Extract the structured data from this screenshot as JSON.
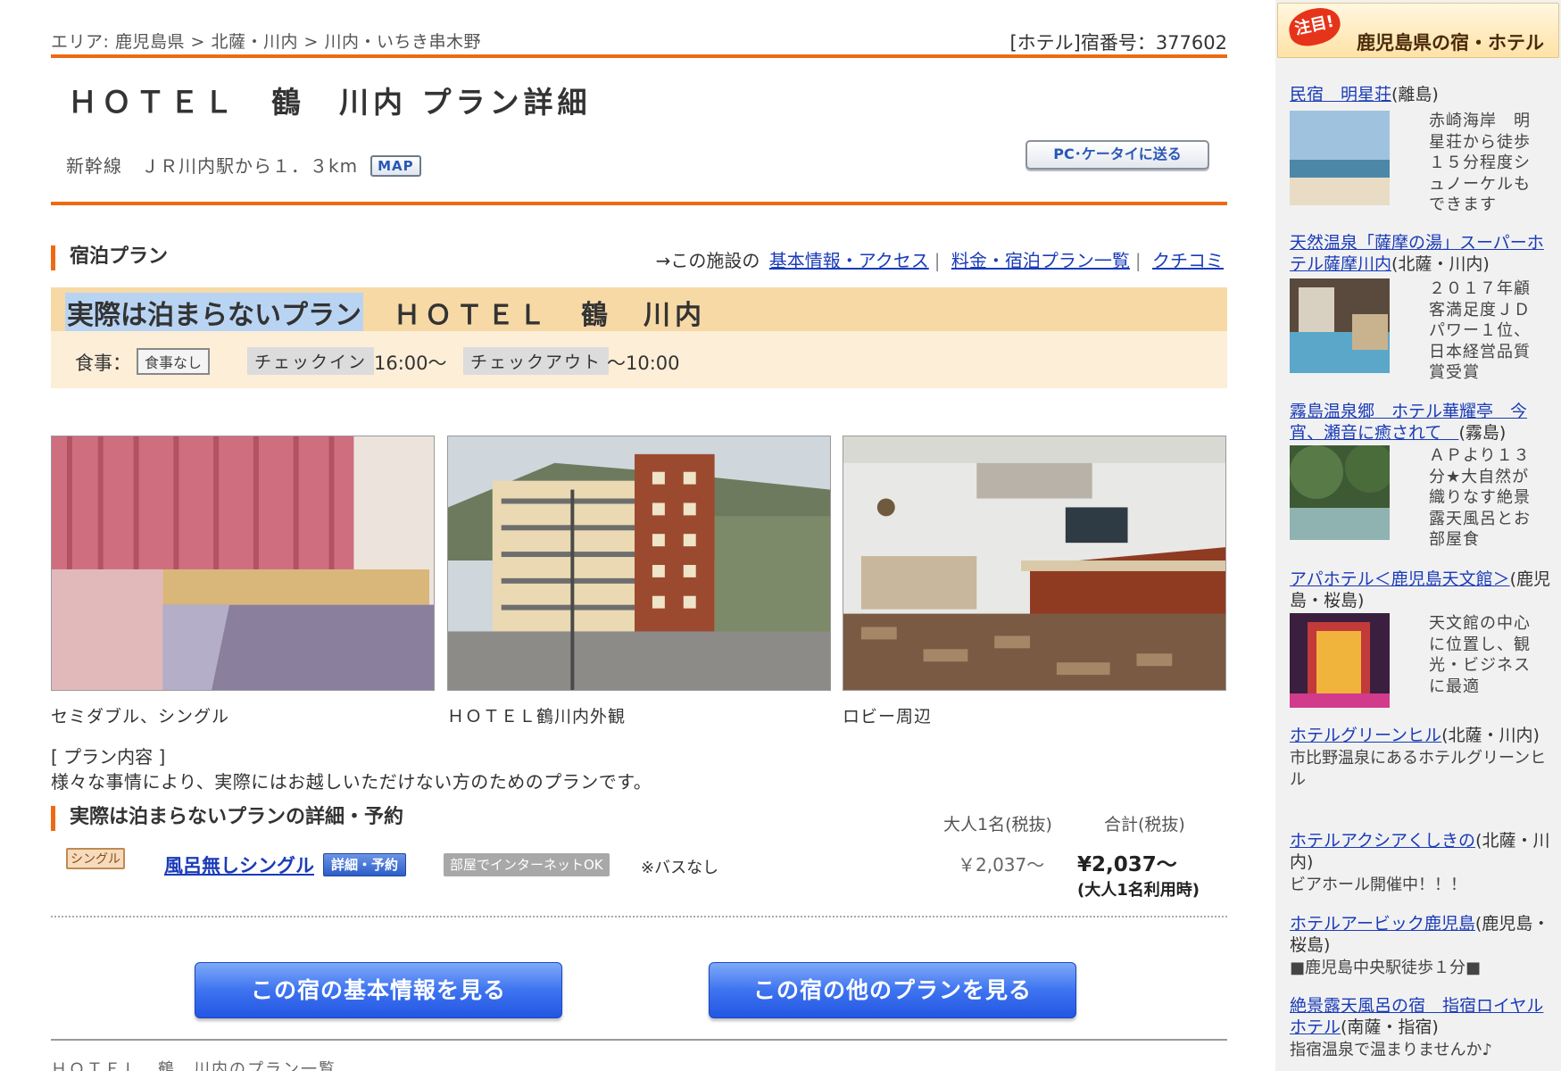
{
  "breadcrumb": {
    "prefix": "エリア:",
    "items": [
      "鹿児島県",
      "北薩・川内",
      "川内・いちき串木野"
    ],
    "sep": " > "
  },
  "yado_number": "[ホテル]宿番号：377602",
  "hotel_title": "ＨＯＴＥＬ　鶴　川内 プラン詳細",
  "access": "新幹線　ＪＲ川内駅から１．３km",
  "map_button": "MAP",
  "send_button": "PC･ケータイに送る",
  "plan_section": {
    "heading": "宿泊プラン",
    "links_prefix": "→この施設の",
    "links": [
      "基本情報・アクセス",
      "料金・宿泊プラン一覧",
      "クチコミ"
    ],
    "link_sep": "|"
  },
  "plan": {
    "name": "実際は泊まらないプラン",
    "hotel": "ＨＯＴＥＬ　鶴　川内",
    "meal_label": "食事：",
    "meal_value": "食事なし",
    "checkin_label": "チェックイン",
    "checkin_value": "16:00〜",
    "checkout_label": "チェックアウト",
    "checkout_value": "〜10:00"
  },
  "photos": [
    {
      "caption": "セミダブル、シングル"
    },
    {
      "caption": "ＨＯＴＥＬ鶴川内外観"
    },
    {
      "caption": "ロビー周辺"
    }
  ],
  "plan_content": {
    "label": "[ プラン内容 ]",
    "text": "様々な事情により、実際にはお越しいただけない方のためのプランです。"
  },
  "detail_section": {
    "heading": "実際は泊まらないプランの詳細・予約",
    "col_adult": "大人1名(税抜)",
    "col_total": "合計(税抜)"
  },
  "room": {
    "type": "シングル",
    "name": "風呂無しシングル",
    "detail_button": "詳細・予約",
    "net_tag": "部屋でインターネットOK",
    "note": "※バスなし",
    "price_adult": "￥2,037〜",
    "price_total": "¥2,037〜",
    "price_note": "(大人1名利用時)"
  },
  "buttons": {
    "basic_info": "この宿の基本情報を見る",
    "other_plans": "この宿の他のプランを見る"
  },
  "footer_title": "ＨＯＴＥＬ　鶴　川内のプラン一覧",
  "sidebar": {
    "badge": "注目!",
    "title": "鹿児島県の宿・ホテル",
    "items": [
      {
        "name": "民宿　明星荘",
        "area": "(離島)",
        "desc": "赤崎海岸　明星荘から徒歩１５分程度シュノーケルもできます"
      },
      {
        "name": "天然温泉「薩摩の湯」スーパーホテル薩摩川内",
        "area": "(北薩・川内)",
        "desc": "２０１７年顧客満足度ＪＤパワー１位、日本経営品質賞受賞"
      },
      {
        "name": "霧島温泉郷　ホテル華耀亭　今宵、瀬音に癒されて　",
        "area": "(霧島)",
        "desc": "ＡＰより１３分★大自然が織りなす絶景露天風呂とお部屋食"
      },
      {
        "name": "アパホテル＜鹿児島天文館＞",
        "area": "(鹿児島・桜島)",
        "desc": "天文館の中心に位置し、観光・ビジネスに最適"
      },
      {
        "name": "ホテルグリーンヒル",
        "area": "(北薩・川内)",
        "desc": "市比野温泉にあるホテルグリーンヒル"
      },
      {
        "name": "ホテルアクシアくしきの",
        "area": "(北薩・川内)",
        "desc": "ビアホール開催中！！！"
      },
      {
        "name": "ホテルアービック鹿児島",
        "area": "(鹿児島・桜島)",
        "desc": "■鹿児島中央駅徒歩１分■"
      },
      {
        "name": "絶景露天風呂の宿　指宿ロイヤルホテル",
        "area": "(南薩・指宿)",
        "desc": "指宿温泉で温まりませんか♪"
      }
    ]
  },
  "colors": {
    "accent_orange": "#ee6a12",
    "plan_band": "#f7d9a6",
    "meal_band": "#fdeed7",
    "link_blue": "#1a3bb8",
    "button_blue": "#3e73f0"
  }
}
